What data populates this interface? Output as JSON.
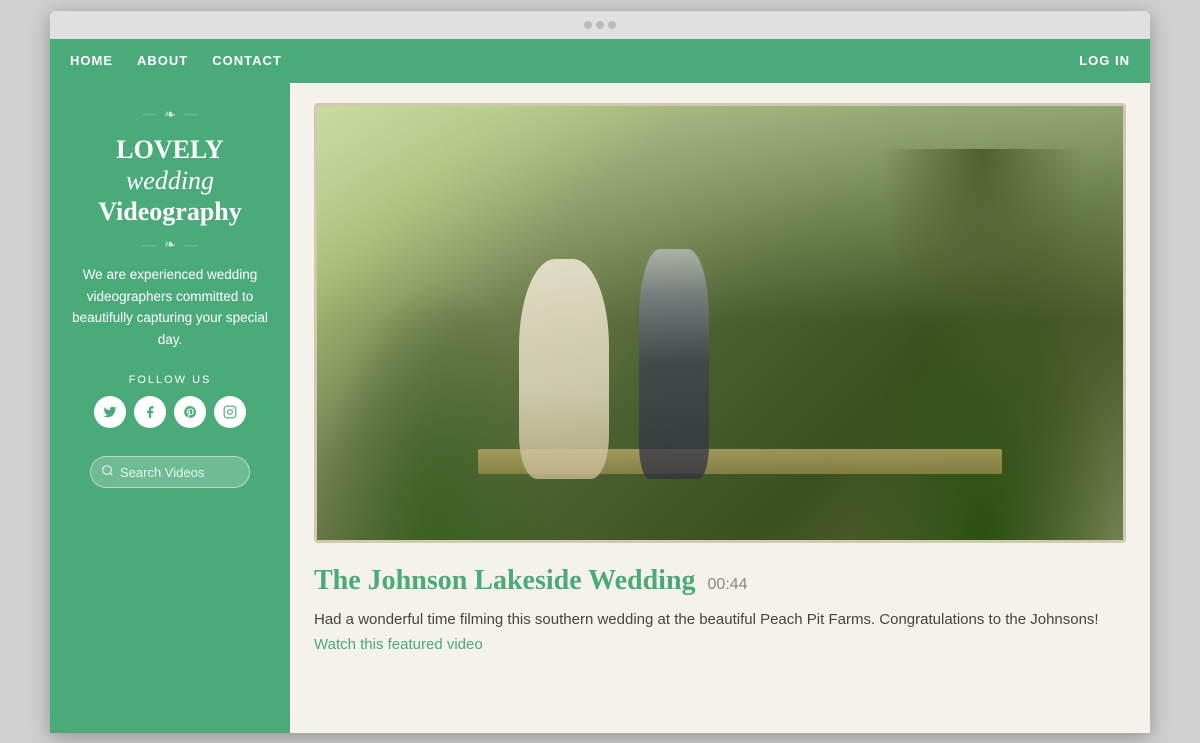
{
  "browser": {
    "tab_dot": "·"
  },
  "nav": {
    "items": [
      "HOME",
      "ABOUT",
      "CONTACT"
    ],
    "login": "LOG IN"
  },
  "sidebar": {
    "ornament_top": "✦ ❧ ✦",
    "title_line1": "LOVELY",
    "title_line2": "wedding",
    "title_line3": "Videography",
    "ornament_bottom": "✦ ❧ ✦",
    "description": "We are experienced wedding videographers committed to beautifully capturing your special day.",
    "follow_label": "FOLLOW US",
    "social": [
      {
        "name": "twitter",
        "symbol": "t"
      },
      {
        "name": "facebook",
        "symbol": "f"
      },
      {
        "name": "pinterest",
        "symbol": "p"
      },
      {
        "name": "instagram",
        "symbol": "i"
      }
    ],
    "search_placeholder": "Search Videos"
  },
  "post": {
    "title": "The Johnson Lakeside Wedding",
    "duration": "00:44",
    "description": "Had a wonderful time filming this southern wedding at the beautiful Peach Pit Farms. Congratulations to the Johnsons!",
    "link_text": "Watch this featured video"
  }
}
